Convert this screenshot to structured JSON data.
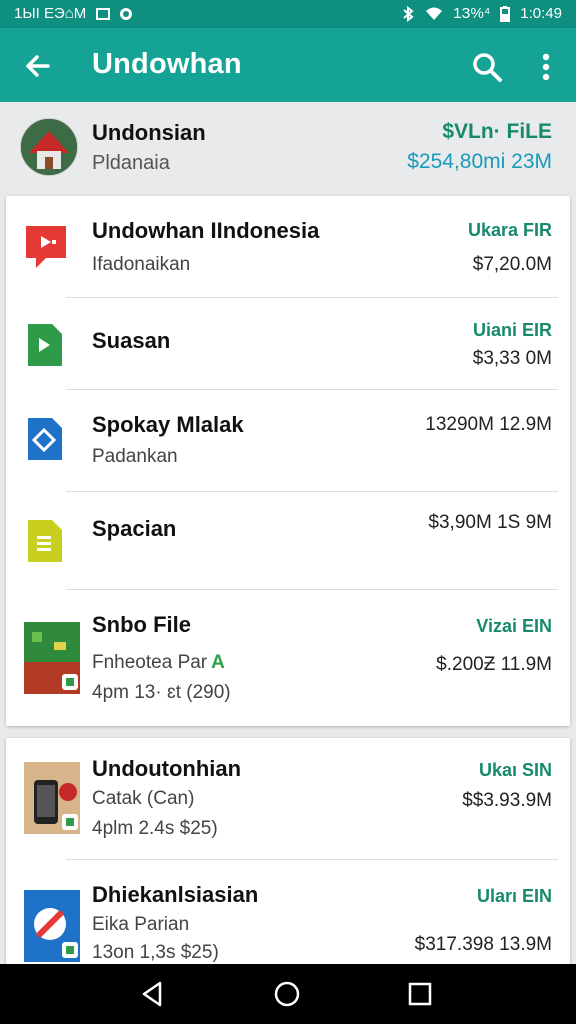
{
  "status_bar": {
    "left_text": "1ЫI ЕЭ⌂М",
    "right_text": "‡ΰ%⁴ 🔋 1:0:49",
    "battery_text": "1З%⁴",
    "time": "1:0:49"
  },
  "toolbar": {
    "title": "Undowhan",
    "icons": [
      "back-arrow-icon",
      "search-icon",
      "more-vert-icon"
    ]
  },
  "header": {
    "title": "Undonsian",
    "subtitle": "Pldanaia",
    "right_top": "$VLn· FiLE",
    "right_bottom": "$254,80mi 23M"
  },
  "card1_rows": [
    {
      "name": "Undowhan IIndonesia",
      "sub": "Ifadonaikan",
      "tag": "Ukara FIR",
      "value": "$7,20.0M",
      "icon": "youtube-play-icon"
    },
    {
      "name": "Suasan",
      "sub": "",
      "tag": "Uiani EIR",
      "value": "$3,33 0M",
      "icon": "sheets-play-icon"
    },
    {
      "name": "Spokay Mlalak",
      "sub": "Padankan",
      "tag": "",
      "value": "13290M 12.9M",
      "icon": "diamond-doc-icon"
    },
    {
      "name": "Spacian",
      "sub": "",
      "tag": "",
      "value": "$3,90M 1S 9M",
      "icon": "slides-doc-icon"
    },
    {
      "name": "Snbo File",
      "sub": "Fnheotea Par",
      "sub_accent": "A",
      "sub2": "4pm 13· ɛt (290)",
      "tag": "Vizai EIN",
      "value": "$.200Ƶ 11.9M",
      "icon": "game-thumb-icon"
    }
  ],
  "card2_rows": [
    {
      "name": "Undoutonhian",
      "sub": "Catak (Can)",
      "sub2": "4plm 2.4s $25)",
      "tag": "Ukaı SIN",
      "value": "$$3.93.9M",
      "icon": "phone-thumb-icon"
    },
    {
      "name": "Dhiekanlsiasian",
      "sub": "Eika Parian",
      "sub2": "13on 1,3s $25)",
      "tag": "Uları EIN",
      "value": "$317.398 13.9M",
      "icon": "blocked-thumb-icon"
    }
  ],
  "nav": [
    "back-nav-icon",
    "home-nav-icon",
    "recents-nav-icon"
  ],
  "colors": {
    "toolbar": "#14a394",
    "status": "#0f8f80",
    "accent_green": "#178a6e"
  }
}
